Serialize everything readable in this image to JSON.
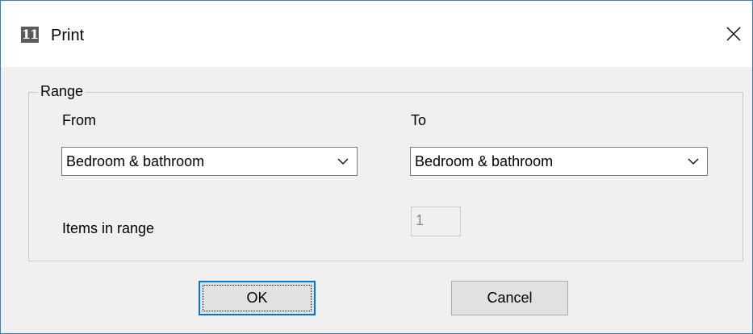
{
  "window": {
    "title": "Print",
    "icon_text": "11",
    "icon": "app-icon",
    "close_icon": "close-icon"
  },
  "range": {
    "group_label": "Range",
    "from_label": "From",
    "to_label": "To",
    "from_value": "Bedroom & bathroom",
    "to_value": "Bedroom & bathroom",
    "items_label": "Items in range",
    "items_value": "1"
  },
  "buttons": {
    "ok": "OK",
    "cancel": "Cancel"
  },
  "colors": {
    "focus_border": "#0078d7",
    "window_border": "#3c7fb1"
  }
}
